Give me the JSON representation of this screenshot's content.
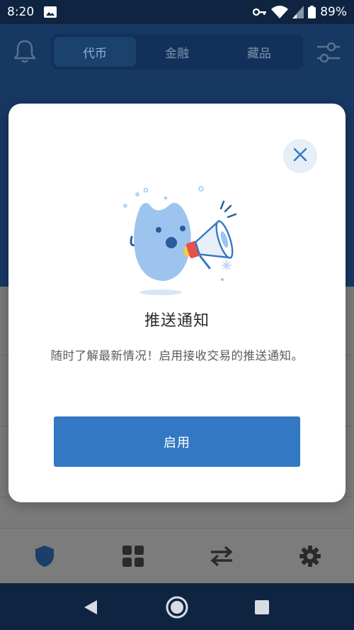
{
  "status_bar": {
    "time": "8:20",
    "battery": "89%",
    "icons": [
      "image-icon",
      "key-icon",
      "wifi-icon",
      "signal-icon",
      "battery-icon"
    ]
  },
  "header": {
    "tabs": [
      {
        "label": "代币",
        "active": true
      },
      {
        "label": "金融",
        "active": false
      },
      {
        "label": "藏品",
        "active": false
      }
    ],
    "left_icon": "bell-icon",
    "right_icon": "filter-icon"
  },
  "modal": {
    "title": "推送通知",
    "body": "随时了解最新情况！启用接收交易的推送通知。",
    "enable_label": "启用",
    "close_icon": "close-icon",
    "illustration": "mascot-megaphone-illustration"
  },
  "bottom_nav": {
    "items": [
      "shield-icon",
      "apps-icon",
      "swap-icon",
      "settings-icon"
    ]
  },
  "system_nav": {
    "items": [
      "back-icon",
      "home-icon",
      "recents-icon"
    ]
  },
  "colors": {
    "primary": "#3278c3",
    "header_bg": "#173863",
    "close_bg": "#e6eef8",
    "mascot": "#9cc4ef",
    "megaphone_red": "#e8504a",
    "megaphone_yellow": "#f5c84a"
  }
}
